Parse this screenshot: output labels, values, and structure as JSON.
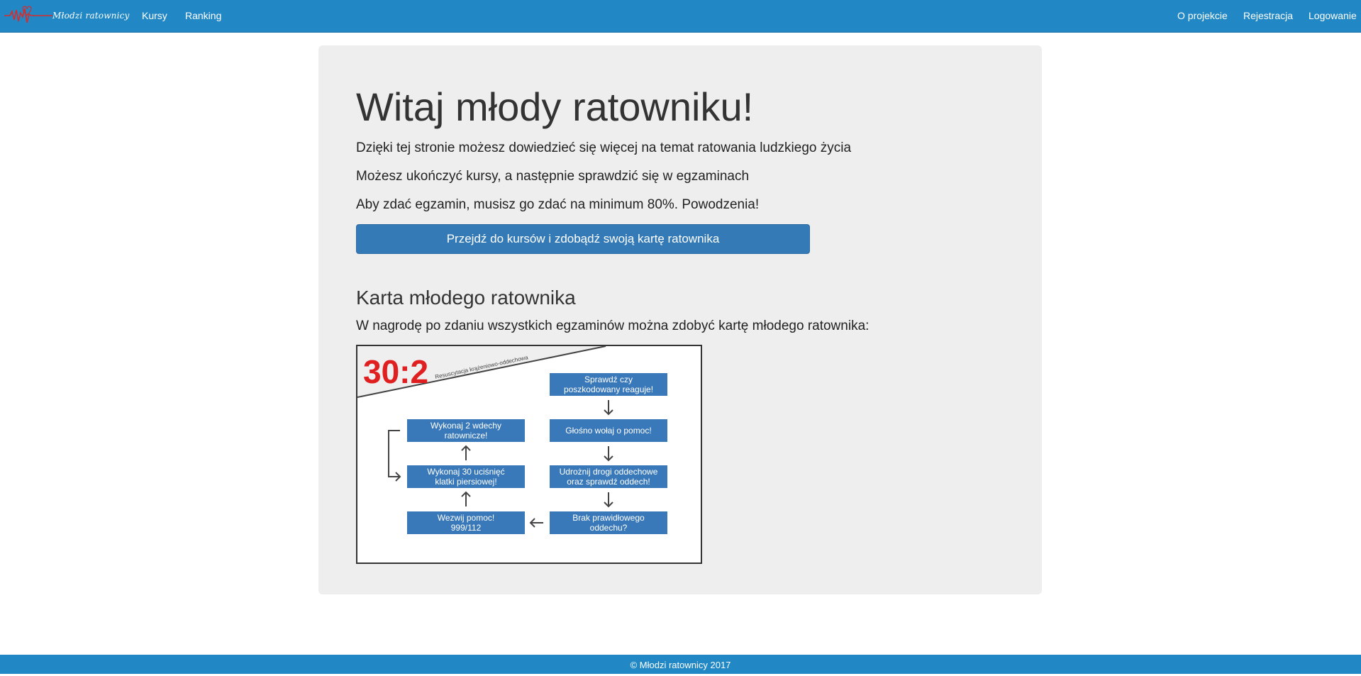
{
  "colors": {
    "navbar": "#2188c5",
    "button": "#337ab7",
    "jumbotron": "#eeeeee",
    "card_red": "#e02020",
    "card_box": "#3a79b9"
  },
  "brand": {
    "text": "Młodzi ratownicy"
  },
  "nav": {
    "left": [
      "Kursy",
      "Ranking"
    ],
    "right": [
      "O projekcie",
      "Rejestracja",
      "Logowanie"
    ]
  },
  "hero": {
    "title": "Witaj młody ratowniku!",
    "paragraphs": [
      "Dzięki tej stronie możesz dowiedzieć się więcej na temat ratowania ludzkiego życia",
      "Możesz ukończyć kursy, a następnie sprawdzić się w egzaminach",
      "Aby zdać egzamin, musisz go zdać na minimum 80%. Powodzenia!"
    ],
    "cta_label": "Przejdź do kursów i zdobądź swoją kartę ratownika"
  },
  "card_section": {
    "title": "Karta młodego ratownika",
    "text": "W nagrodę po zdaniu wszystkich egzaminów można zdobyć kartę młodego ratownika:"
  },
  "card": {
    "ratio": "30:2",
    "subtitle": "Resuscytacja krążeniowo-oddechowa",
    "right_boxes": [
      {
        "line1": "Sprawdź czy",
        "line2": "poszkodowany reaguje!"
      },
      {
        "line1": "Głośno wołaj o pomoc!",
        "line2": ""
      },
      {
        "line1": "Udrożnij drogi oddechowe",
        "line2": "oraz sprawdź oddech!"
      },
      {
        "line1": "Brak prawidłowego",
        "line2": "oddechu?"
      }
    ],
    "left_boxes": [
      {
        "line1": "Wykonaj 2 wdechy",
        "line2": "ratownicze!"
      },
      {
        "line1": "Wykonaj 30 uciśnięć",
        "line2": "klatki piersiowej!"
      },
      {
        "line1": "Wezwij pomoc!",
        "line2": "999/112"
      }
    ]
  },
  "footer": {
    "text": "© Młodzi ratownicy 2017"
  }
}
